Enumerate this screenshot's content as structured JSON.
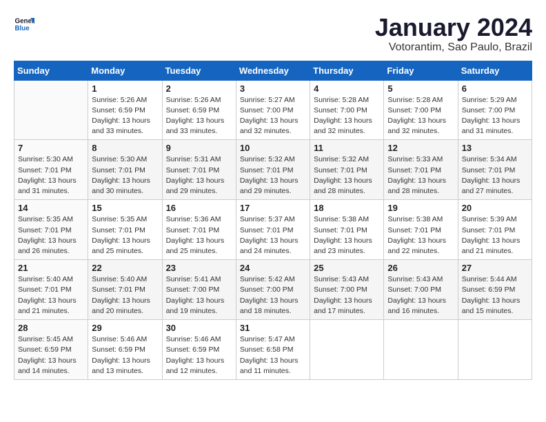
{
  "logo": {
    "line1": "General",
    "line2": "Blue"
  },
  "title": "January 2024",
  "subtitle": "Votorantim, Sao Paulo, Brazil",
  "headers": [
    "Sunday",
    "Monday",
    "Tuesday",
    "Wednesday",
    "Thursday",
    "Friday",
    "Saturday"
  ],
  "weeks": [
    [
      {
        "day": "",
        "detail": ""
      },
      {
        "day": "1",
        "detail": "Sunrise: 5:26 AM\nSunset: 6:59 PM\nDaylight: 13 hours\nand 33 minutes."
      },
      {
        "day": "2",
        "detail": "Sunrise: 5:26 AM\nSunset: 6:59 PM\nDaylight: 13 hours\nand 33 minutes."
      },
      {
        "day": "3",
        "detail": "Sunrise: 5:27 AM\nSunset: 7:00 PM\nDaylight: 13 hours\nand 32 minutes."
      },
      {
        "day": "4",
        "detail": "Sunrise: 5:28 AM\nSunset: 7:00 PM\nDaylight: 13 hours\nand 32 minutes."
      },
      {
        "day": "5",
        "detail": "Sunrise: 5:28 AM\nSunset: 7:00 PM\nDaylight: 13 hours\nand 32 minutes."
      },
      {
        "day": "6",
        "detail": "Sunrise: 5:29 AM\nSunset: 7:00 PM\nDaylight: 13 hours\nand 31 minutes."
      }
    ],
    [
      {
        "day": "7",
        "detail": "Sunrise: 5:30 AM\nSunset: 7:01 PM\nDaylight: 13 hours\nand 31 minutes."
      },
      {
        "day": "8",
        "detail": "Sunrise: 5:30 AM\nSunset: 7:01 PM\nDaylight: 13 hours\nand 30 minutes."
      },
      {
        "day": "9",
        "detail": "Sunrise: 5:31 AM\nSunset: 7:01 PM\nDaylight: 13 hours\nand 29 minutes."
      },
      {
        "day": "10",
        "detail": "Sunrise: 5:32 AM\nSunset: 7:01 PM\nDaylight: 13 hours\nand 29 minutes."
      },
      {
        "day": "11",
        "detail": "Sunrise: 5:32 AM\nSunset: 7:01 PM\nDaylight: 13 hours\nand 28 minutes."
      },
      {
        "day": "12",
        "detail": "Sunrise: 5:33 AM\nSunset: 7:01 PM\nDaylight: 13 hours\nand 28 minutes."
      },
      {
        "day": "13",
        "detail": "Sunrise: 5:34 AM\nSunset: 7:01 PM\nDaylight: 13 hours\nand 27 minutes."
      }
    ],
    [
      {
        "day": "14",
        "detail": "Sunrise: 5:35 AM\nSunset: 7:01 PM\nDaylight: 13 hours\nand 26 minutes."
      },
      {
        "day": "15",
        "detail": "Sunrise: 5:35 AM\nSunset: 7:01 PM\nDaylight: 13 hours\nand 25 minutes."
      },
      {
        "day": "16",
        "detail": "Sunrise: 5:36 AM\nSunset: 7:01 PM\nDaylight: 13 hours\nand 25 minutes."
      },
      {
        "day": "17",
        "detail": "Sunrise: 5:37 AM\nSunset: 7:01 PM\nDaylight: 13 hours\nand 24 minutes."
      },
      {
        "day": "18",
        "detail": "Sunrise: 5:38 AM\nSunset: 7:01 PM\nDaylight: 13 hours\nand 23 minutes."
      },
      {
        "day": "19",
        "detail": "Sunrise: 5:38 AM\nSunset: 7:01 PM\nDaylight: 13 hours\nand 22 minutes."
      },
      {
        "day": "20",
        "detail": "Sunrise: 5:39 AM\nSunset: 7:01 PM\nDaylight: 13 hours\nand 21 minutes."
      }
    ],
    [
      {
        "day": "21",
        "detail": "Sunrise: 5:40 AM\nSunset: 7:01 PM\nDaylight: 13 hours\nand 21 minutes."
      },
      {
        "day": "22",
        "detail": "Sunrise: 5:40 AM\nSunset: 7:01 PM\nDaylight: 13 hours\nand 20 minutes."
      },
      {
        "day": "23",
        "detail": "Sunrise: 5:41 AM\nSunset: 7:00 PM\nDaylight: 13 hours\nand 19 minutes."
      },
      {
        "day": "24",
        "detail": "Sunrise: 5:42 AM\nSunset: 7:00 PM\nDaylight: 13 hours\nand 18 minutes."
      },
      {
        "day": "25",
        "detail": "Sunrise: 5:43 AM\nSunset: 7:00 PM\nDaylight: 13 hours\nand 17 minutes."
      },
      {
        "day": "26",
        "detail": "Sunrise: 5:43 AM\nSunset: 7:00 PM\nDaylight: 13 hours\nand 16 minutes."
      },
      {
        "day": "27",
        "detail": "Sunrise: 5:44 AM\nSunset: 6:59 PM\nDaylight: 13 hours\nand 15 minutes."
      }
    ],
    [
      {
        "day": "28",
        "detail": "Sunrise: 5:45 AM\nSunset: 6:59 PM\nDaylight: 13 hours\nand 14 minutes."
      },
      {
        "day": "29",
        "detail": "Sunrise: 5:46 AM\nSunset: 6:59 PM\nDaylight: 13 hours\nand 13 minutes."
      },
      {
        "day": "30",
        "detail": "Sunrise: 5:46 AM\nSunset: 6:59 PM\nDaylight: 13 hours\nand 12 minutes."
      },
      {
        "day": "31",
        "detail": "Sunrise: 5:47 AM\nSunset: 6:58 PM\nDaylight: 13 hours\nand 11 minutes."
      },
      {
        "day": "",
        "detail": ""
      },
      {
        "day": "",
        "detail": ""
      },
      {
        "day": "",
        "detail": ""
      }
    ]
  ]
}
